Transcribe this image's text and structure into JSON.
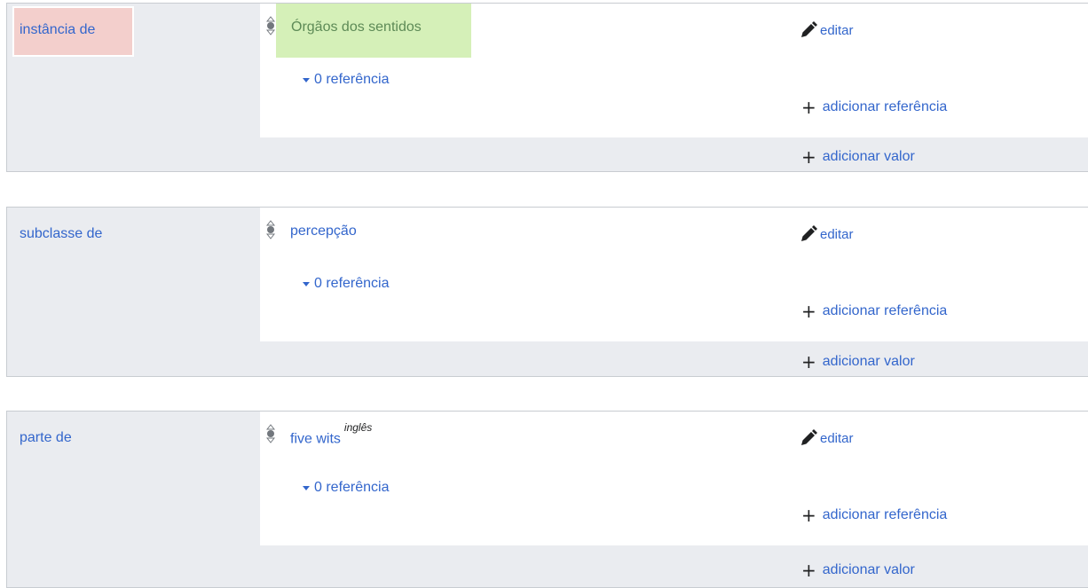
{
  "statements": [
    {
      "property": "instância de",
      "value": "Órgãos dos sentidos",
      "value_lang": "",
      "edit_label": "editar",
      "references_label": "0 referência",
      "add_reference_label": "adicionar referência",
      "add_value_label": "adicionar valor"
    },
    {
      "property": "subclasse de",
      "value": "percepção",
      "value_lang": "",
      "edit_label": "editar",
      "references_label": "0 referência",
      "add_reference_label": "adicionar referência",
      "add_value_label": "adicionar valor"
    },
    {
      "property": "parte de",
      "value": "five wits",
      "value_lang": "inglês",
      "edit_label": "editar",
      "references_label": "0 referência",
      "add_reference_label": "adicionar referência",
      "add_value_label": "adicionar valor"
    }
  ],
  "icons": {
    "rank": "rank-selector-icon",
    "edit": "pencil-icon",
    "add": "plus-icon",
    "toggle": "caret-down-icon"
  },
  "colors": {
    "link": "#3366cc",
    "label_background": "#eaecf0",
    "highlight_property": "#f3cfcc",
    "highlight_value": "#d5f0b8"
  }
}
